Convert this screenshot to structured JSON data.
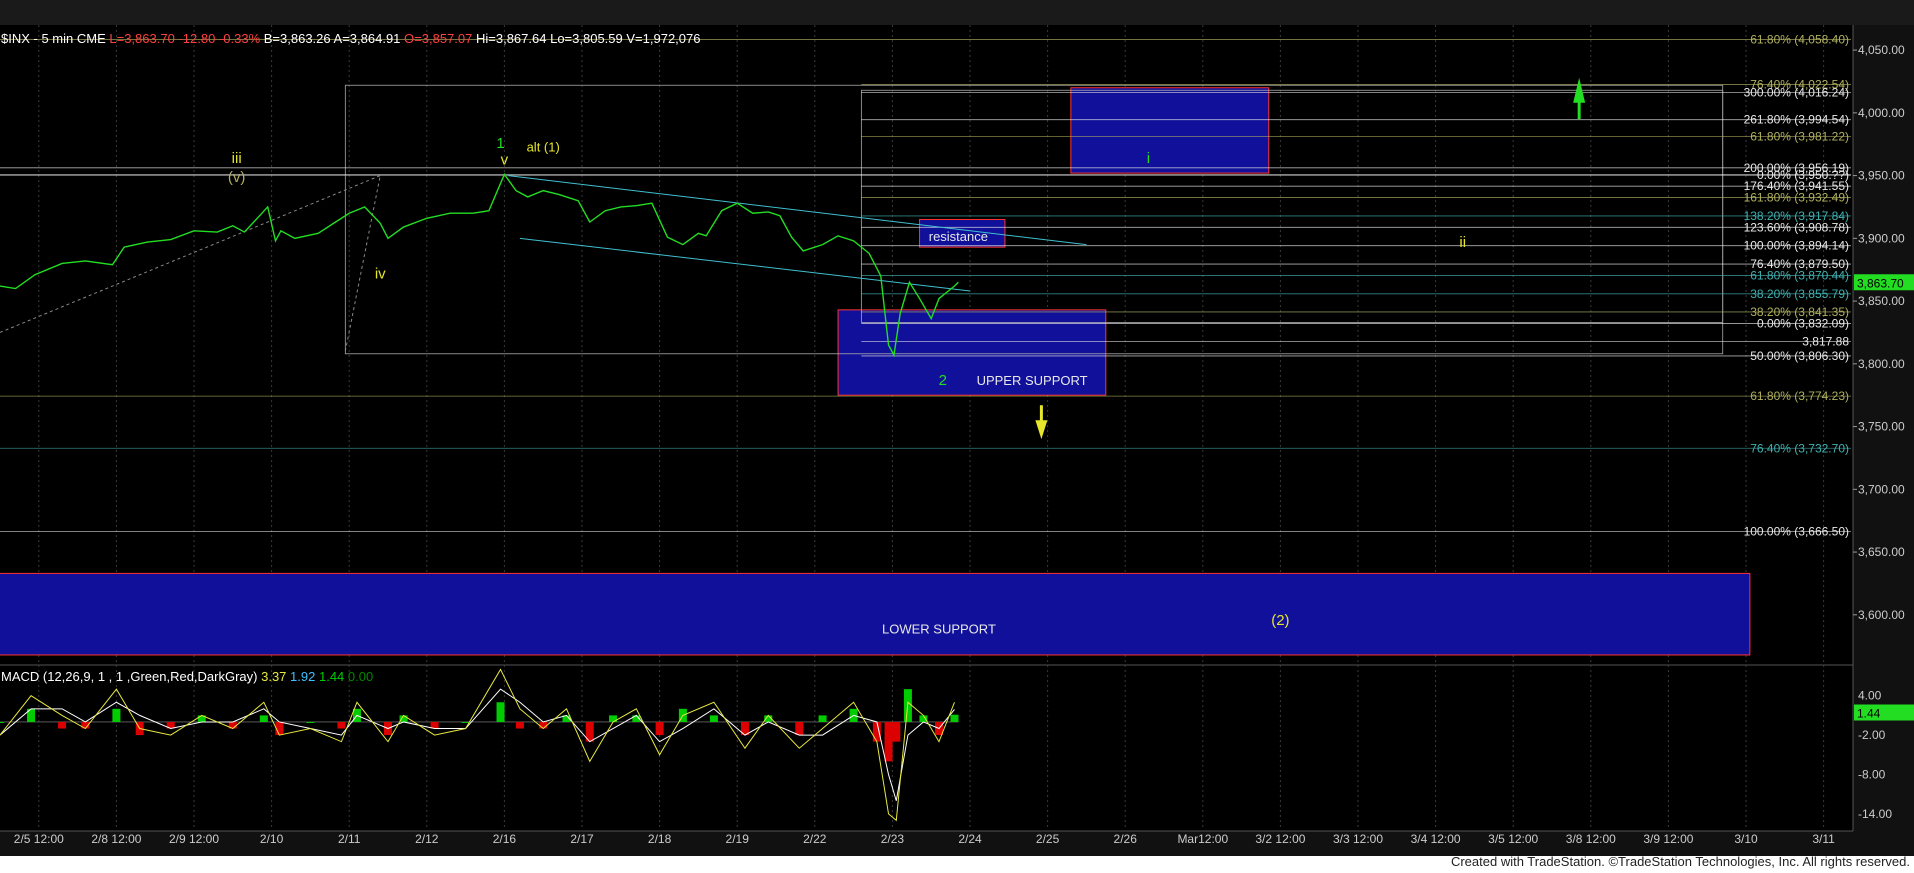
{
  "header": {
    "symbol": "$INX - 5 min  CME",
    "last": "L=3,863.70",
    "change": "-12.80",
    "change_pct": "-0.33%",
    "bid": "B=3,863.26",
    "ask": "A=3,864.91",
    "open": "O=3,857.07",
    "high": "Hi=3,867.64",
    "low": "Lo=3,805.59",
    "volume": "V=1,972,076"
  },
  "macd_header": {
    "label": "MACD (12,26,9, 1 , 1 ,Green,Red,DarkGray)",
    "v1": "3.37",
    "v2": "1.92",
    "v3": "1.44",
    "v4": "0.00"
  },
  "credit": "Created with TradeStation. ©TradeStation Technologies, Inc. All rights reserved.",
  "colors": {
    "price": "#22dd22",
    "fib_olive": "#b0b060",
    "fib_teal": "#40b0b0",
    "fib_white": "#e8e8e8",
    "box": "#10109a",
    "wave_yellow": "#e6e62a",
    "macd_yellow": "#e8e840",
    "macd_white": "#ffffff",
    "hist_green": "#00cc00",
    "hist_red": "#dd0000"
  },
  "chart_data": {
    "type": "line",
    "title": "$INX - 5 min  CME",
    "ylim": [
      3560,
      4070
    ],
    "y_ticks": [
      "4,050.00",
      "4,000.00",
      "3,950.00",
      "3,900.00",
      "3,850.00",
      "3,800.00",
      "3,750.00",
      "3,700.00",
      "3,650.00",
      "3,600.00"
    ],
    "y_tick_values": [
      4050,
      4000,
      3950,
      3900,
      3850,
      3800,
      3750,
      3700,
      3650,
      3600
    ],
    "x_ticks": [
      "2/5 12:00",
      "2/8 12:00",
      "2/9 12:00",
      "2/10",
      "2/11",
      "2/12",
      "2/16",
      "2/17",
      "2/18",
      "2/19",
      "2/22",
      "2/23",
      "2/24",
      "2/25",
      "2/26",
      "Mar12:00",
      "3/2 12:00",
      "3/3 12:00",
      "3/4 12:00",
      "3/5 12:00",
      "3/8 12:00",
      "3/9 12:00",
      "3/10",
      "3/11"
    ],
    "x_tick_index": [
      0.5,
      1.5,
      2.5,
      3.5,
      4.5,
      5.5,
      6.5,
      7.5,
      8.5,
      9.5,
      10.5,
      11.5,
      12.5,
      13.5,
      14.5,
      15.5,
      16.5,
      17.5,
      18.5,
      19.5,
      20.5,
      21.5,
      22.5,
      23.5
    ],
    "last_price": "3,863.70",
    "price_series": [
      [
        0.0,
        3862
      ],
      [
        0.2,
        3860
      ],
      [
        0.45,
        3871
      ],
      [
        0.8,
        3880
      ],
      [
        1.1,
        3882
      ],
      [
        1.45,
        3879
      ],
      [
        1.6,
        3893
      ],
      [
        1.9,
        3897
      ],
      [
        2.2,
        3899
      ],
      [
        2.5,
        3906
      ],
      [
        2.8,
        3905
      ],
      [
        3.0,
        3910
      ],
      [
        3.15,
        3905
      ],
      [
        3.45,
        3925
      ],
      [
        3.55,
        3898
      ],
      [
        3.62,
        3906
      ],
      [
        3.8,
        3900
      ],
      [
        4.1,
        3904
      ],
      [
        4.3,
        3912
      ],
      [
        4.5,
        3920
      ],
      [
        4.7,
        3925
      ],
      [
        4.9,
        3912
      ],
      [
        5.0,
        3900
      ],
      [
        5.2,
        3909
      ],
      [
        5.5,
        3916
      ],
      [
        5.8,
        3920
      ],
      [
        6.1,
        3920
      ],
      [
        6.3,
        3922
      ],
      [
        6.5,
        3951
      ],
      [
        6.65,
        3938
      ],
      [
        6.8,
        3933
      ],
      [
        7.0,
        3938
      ],
      [
        7.2,
        3935
      ],
      [
        7.45,
        3930
      ],
      [
        7.6,
        3913
      ],
      [
        7.8,
        3922
      ],
      [
        8.0,
        3925
      ],
      [
        8.2,
        3926
      ],
      [
        8.4,
        3928
      ],
      [
        8.6,
        3901
      ],
      [
        8.8,
        3895
      ],
      [
        9.0,
        3904
      ],
      [
        9.1,
        3902
      ],
      [
        9.3,
        3922
      ],
      [
        9.5,
        3928
      ],
      [
        9.7,
        3920
      ],
      [
        9.9,
        3921
      ],
      [
        10.05,
        3918
      ],
      [
        10.2,
        3901
      ],
      [
        10.35,
        3890
      ],
      [
        10.6,
        3895
      ],
      [
        10.8,
        3902
      ],
      [
        11.0,
        3898
      ],
      [
        11.2,
        3888
      ],
      [
        11.35,
        3870
      ],
      [
        11.45,
        3815
      ],
      [
        11.52,
        3807
      ],
      [
        11.6,
        3840
      ],
      [
        11.72,
        3865
      ],
      [
        11.85,
        3852
      ],
      [
        12.0,
        3836
      ],
      [
        12.1,
        3852
      ],
      [
        12.3,
        3862
      ],
      [
        12.35,
        3865
      ]
    ],
    "fib_levels_right": [
      {
        "label": "61.80% (4,058.40)",
        "value": 4058.4,
        "color": "olive"
      },
      {
        "label": "76.40% (4,022.54)",
        "value": 4022.54,
        "color": "olive"
      },
      {
        "label": "300.00% (4,016.24)",
        "value": 4016.24,
        "color": "white"
      },
      {
        "label": "261.80% (3,994.54)",
        "value": 3994.54,
        "color": "white"
      },
      {
        "label": "61.80% (3,981.22)",
        "value": 3981.22,
        "color": "olive"
      },
      {
        "label": "200.00% (3,956.19)",
        "value": 3956.19,
        "color": "white"
      },
      {
        "label": "0.00% (3,950.??)",
        "value": 3950.5,
        "color": "white"
      },
      {
        "label": "176.40% (3,941.55)",
        "value": 3941.55,
        "color": "white"
      },
      {
        "label": "161.80% (3,932.49)",
        "value": 3932.49,
        "color": "olive"
      },
      {
        "label": "138.20% (3,917.84)",
        "value": 3917.84,
        "color": "teal"
      },
      {
        "label": "123.60% (3,908.78)",
        "value": 3908.78,
        "color": "white"
      },
      {
        "label": "100.00% (3,894.14)",
        "value": 3894.14,
        "color": "white"
      },
      {
        "label": "76.40% (3,879.50)",
        "value": 3879.5,
        "color": "white"
      },
      {
        "label": "61.80% (3,870.44)",
        "value": 3870.44,
        "color": "teal"
      },
      {
        "label": "38.20% (3,855.79)",
        "value": 3855.79,
        "color": "teal"
      },
      {
        "label": "38.20% (3,841.35)",
        "value": 3841.35,
        "color": "olive"
      },
      {
        "label": "0.00% (3,832.09)",
        "value": 3832.09,
        "color": "white"
      },
      {
        "label": "3,817.88",
        "value": 3817.88,
        "color": "white"
      },
      {
        "label": "50.00% (3,806.30)",
        "value": 3806.3,
        "color": "white"
      },
      {
        "label": "61.80% (3,774.23)",
        "value": 3774.23,
        "color": "olive"
      },
      {
        "label": "76.40% (3,732.70)",
        "value": 3732.7,
        "color": "teal"
      },
      {
        "label": "100.00% (3,666.50)",
        "value": 3666.5,
        "color": "white"
      }
    ],
    "wave_labels": [
      {
        "text": "iii",
        "x": 3.05,
        "y": 3960,
        "color": "yellow"
      },
      {
        "text": "(v)",
        "x": 3.05,
        "y": 3945,
        "color": "olive"
      },
      {
        "text": "iv",
        "x": 4.9,
        "y": 3868,
        "color": "yellow"
      },
      {
        "text": "1",
        "x": 6.45,
        "y": 3972,
        "color": "green"
      },
      {
        "text": "v",
        "x": 6.5,
        "y": 3959,
        "color": "yellow"
      },
      {
        "text": "alt (1)",
        "x": 7.0,
        "y": 3969,
        "color": "yellow"
      },
      {
        "text": "i",
        "x": 14.8,
        "y": 3960,
        "color": "green"
      },
      {
        "text": "resistance",
        "x": 12.35,
        "y": 3898,
        "color": "white"
      },
      {
        "text": "ii",
        "x": 18.85,
        "y": 3893,
        "color": "yellow"
      },
      {
        "text": "2",
        "x": 12.15,
        "y": 3783,
        "color": "green"
      },
      {
        "text": "UPPER SUPPORT",
        "x": 13.3,
        "y": 3783,
        "color": "white"
      },
      {
        "text": "LOWER SUPPORT",
        "x": 12.1,
        "y": 3585,
        "color": "white"
      },
      {
        "text": "(2)",
        "x": 16.5,
        "y": 3592,
        "color": "yellow"
      }
    ],
    "boxes": [
      {
        "x0": 13.8,
        "x1": 16.35,
        "y0": 3952,
        "y1": 4020,
        "fill": "box",
        "border": "#ff3333"
      },
      {
        "x0": 11.85,
        "x1": 12.95,
        "y0": 3893,
        "y1": 3915,
        "fill": "box",
        "border": "#ff3333"
      },
      {
        "x0": 10.8,
        "x1": 14.25,
        "y0": 3775,
        "y1": 3843,
        "fill": "box",
        "border": "#ff3333"
      },
      {
        "x0": -0.2,
        "x1": 22.55,
        "y0": 3568,
        "y1": 3633,
        "fill": "box",
        "border": "#ff3333"
      }
    ],
    "macd": {
      "ylim": [
        -16,
        7
      ],
      "y_ticks": [
        "4.00",
        "-2.00",
        "-8.00",
        "-14.00"
      ],
      "y_tick_values": [
        4,
        -2,
        -8,
        -14
      ],
      "current": "1.44",
      "macd_line": [
        [
          0,
          -2
        ],
        [
          0.4,
          4
        ],
        [
          0.8,
          1
        ],
        [
          1.1,
          -1
        ],
        [
          1.5,
          5
        ],
        [
          1.8,
          -1
        ],
        [
          2.2,
          -2
        ],
        [
          2.6,
          1
        ],
        [
          3.0,
          -1
        ],
        [
          3.4,
          3
        ],
        [
          3.6,
          -2
        ],
        [
          4.0,
          -1
        ],
        [
          4.4,
          -3
        ],
        [
          4.6,
          3
        ],
        [
          5.0,
          -3
        ],
        [
          5.2,
          1
        ],
        [
          5.6,
          -2
        ],
        [
          6.0,
          -1
        ],
        [
          6.45,
          8
        ],
        [
          6.7,
          2
        ],
        [
          7.0,
          -1
        ],
        [
          7.3,
          2
        ],
        [
          7.6,
          -6
        ],
        [
          7.9,
          0
        ],
        [
          8.2,
          2
        ],
        [
          8.5,
          -5
        ],
        [
          8.8,
          1
        ],
        [
          9.2,
          3
        ],
        [
          9.6,
          -4
        ],
        [
          9.9,
          1
        ],
        [
          10.3,
          -4
        ],
        [
          10.6,
          -1
        ],
        [
          11.0,
          3
        ],
        [
          11.3,
          -3
        ],
        [
          11.45,
          -14
        ],
        [
          11.55,
          -15
        ],
        [
          11.7,
          3
        ],
        [
          11.9,
          1
        ],
        [
          12.1,
          -3
        ],
        [
          12.3,
          3
        ]
      ],
      "signal_line": [
        [
          0,
          -2
        ],
        [
          0.4,
          2
        ],
        [
          0.8,
          2
        ],
        [
          1.1,
          0
        ],
        [
          1.5,
          3
        ],
        [
          1.8,
          1
        ],
        [
          2.2,
          -1
        ],
        [
          2.6,
          0
        ],
        [
          3.0,
          0
        ],
        [
          3.4,
          2
        ],
        [
          3.6,
          0
        ],
        [
          4.0,
          -1
        ],
        [
          4.4,
          -2
        ],
        [
          4.6,
          1
        ],
        [
          5.0,
          -1
        ],
        [
          5.2,
          0
        ],
        [
          5.6,
          -1
        ],
        [
          6.0,
          -1
        ],
        [
          6.45,
          5
        ],
        [
          6.7,
          3
        ],
        [
          7.0,
          0
        ],
        [
          7.3,
          1
        ],
        [
          7.6,
          -3
        ],
        [
          7.9,
          -1
        ],
        [
          8.2,
          1
        ],
        [
          8.5,
          -3
        ],
        [
          8.8,
          -1
        ],
        [
          9.2,
          2
        ],
        [
          9.6,
          -2
        ],
        [
          9.9,
          0
        ],
        [
          10.3,
          -2
        ],
        [
          10.6,
          -2
        ],
        [
          11.0,
          1
        ],
        [
          11.3,
          0
        ],
        [
          11.45,
          -8
        ],
        [
          11.55,
          -12
        ],
        [
          11.7,
          -2
        ],
        [
          11.9,
          0
        ],
        [
          12.1,
          -1
        ],
        [
          12.3,
          1.9
        ]
      ]
    }
  }
}
